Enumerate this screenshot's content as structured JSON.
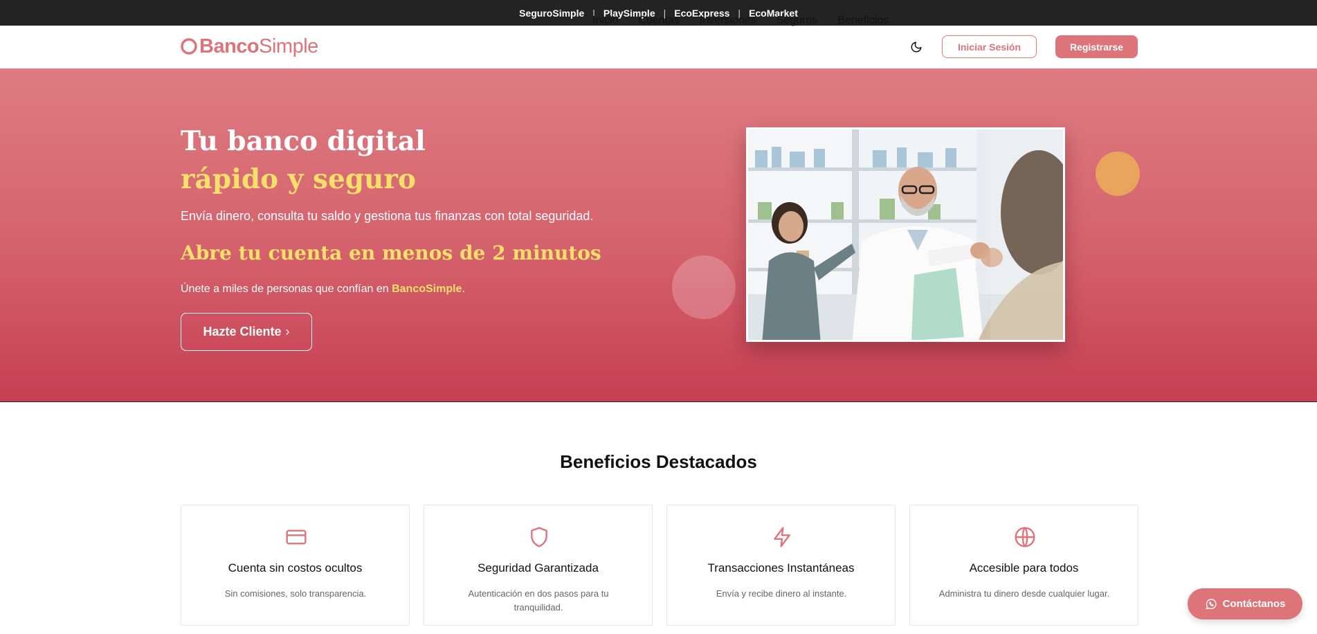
{
  "topbar": {
    "links": [
      "SeguroSimple",
      "PlaySimple",
      "EcoExpress",
      "EcoMarket"
    ],
    "separator": "|"
  },
  "brand": {
    "bold": "Banco",
    "light": "Simple",
    "color": "#dd7479"
  },
  "nav": {
    "items": [
      "Inicio",
      "Cuentas",
      "Inversiones",
      "Seguros",
      "Beneficios"
    ],
    "theme_icon": "moon-icon",
    "login_label": "Iniciar Sesión",
    "register_label": "Registrarse"
  },
  "hero": {
    "title_line1": "Tu banco digital",
    "title_line2": "rápido y seguro",
    "subtitle": "Envía dinero, consulta tu saldo y gestiona tus finanzas con total seguridad.",
    "cta_heading": "Abre tu cuenta en menos de 2 minutos",
    "join_prefix": "Únete a miles de personas que confían en ",
    "join_brand": "BancoSimple",
    "join_suffix": ".",
    "button_label": "Hazte Cliente",
    "button_chevron": "›",
    "accent_color": "#f7e06a"
  },
  "benefits": {
    "title": "Beneficios Destacados",
    "cards": [
      {
        "icon": "credit-card-icon",
        "title": "Cuenta sin costos ocultos",
        "desc": "Sin comisiones, solo transparencia."
      },
      {
        "icon": "shield-icon",
        "title": "Seguridad Garantizada",
        "desc": "Autenticación en dos pasos para tu tranquilidad."
      },
      {
        "icon": "lightning-icon",
        "title": "Transacciones Instantáneas",
        "desc": "Envía y recibe dinero al instante."
      },
      {
        "icon": "globe-icon",
        "title": "Accesible para todos",
        "desc": "Administra tu dinero desde cualquier lugar."
      }
    ]
  },
  "contact": {
    "label": "Contáctanos",
    "icon": "whatsapp-icon"
  }
}
